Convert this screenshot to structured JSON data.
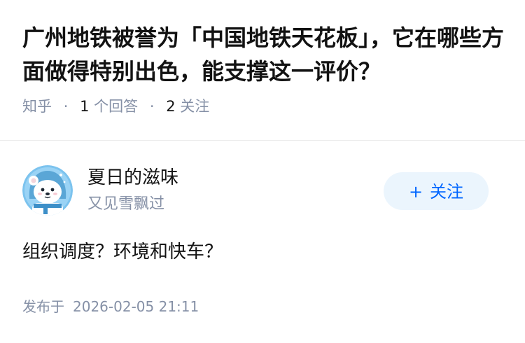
{
  "question": {
    "title": "广州地铁被誉为「中国地铁天花板」，它在哪些方面做得特别出色，能支撑这一评价？",
    "source": "知乎",
    "answer_count": "1",
    "answer_label": "个回答",
    "follower_count": "2",
    "follower_label": "关注"
  },
  "answer": {
    "author_name": "夏日的滋味",
    "author_headline": "又见雪飘过",
    "avatar_icon": "cartoon-bear-avatar",
    "follow_button": {
      "icon": "plus-icon",
      "plus": "+",
      "label": "关注"
    },
    "content": "组织调度？环境和快车？",
    "published_label": "发布于",
    "published_time": "2026-02-05 21:11"
  },
  "colors": {
    "title": "#121212",
    "meta": "#8590a6",
    "accent": "#0066ff",
    "follow_bg": "#ebf5fd",
    "divider": "#ebebeb"
  }
}
